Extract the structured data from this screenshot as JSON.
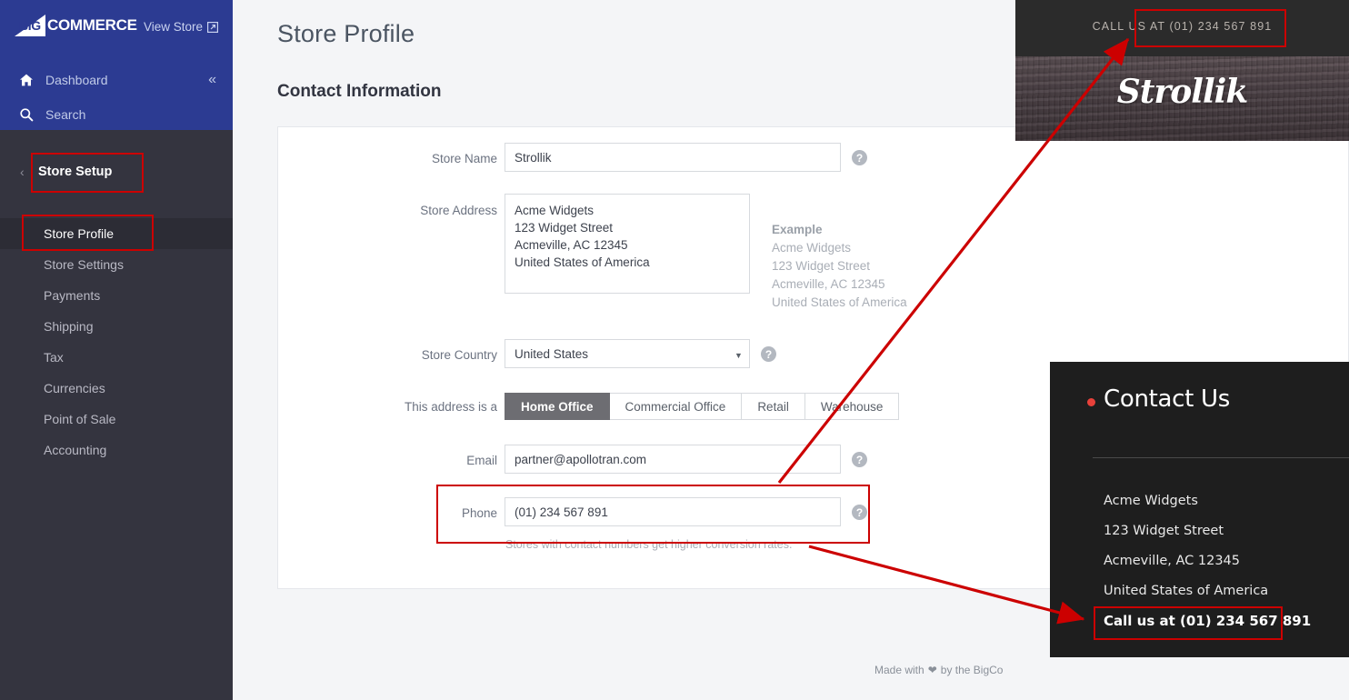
{
  "sidebar": {
    "brand_big": "BIG",
    "brand_name": "COMMERCE",
    "view_store": "View Store",
    "dashboard": "Dashboard",
    "search": "Search",
    "group_label": "Store Setup",
    "items": [
      {
        "label": "Store Profile",
        "active": true
      },
      {
        "label": "Store Settings",
        "active": false
      },
      {
        "label": "Payments",
        "active": false
      },
      {
        "label": "Shipping",
        "active": false
      },
      {
        "label": "Tax",
        "active": false
      },
      {
        "label": "Currencies",
        "active": false
      },
      {
        "label": "Point of Sale",
        "active": false
      },
      {
        "label": "Accounting",
        "active": false
      }
    ]
  },
  "main": {
    "page_title": "Store Profile",
    "section_title": "Contact Information",
    "fields": {
      "store_name_label": "Store Name",
      "store_name_value": "Strollik",
      "store_address_label": "Store Address",
      "store_address_value": "Acme Widgets\n123 Widget Street\nAcmeville, AC 12345\nUnited States of America",
      "example_heading": "Example",
      "example_lines": [
        "Acme Widgets",
        "123 Widget Street",
        "Acmeville, AC 12345",
        "United States of America"
      ],
      "store_country_label": "Store Country",
      "store_country_value": "United States",
      "address_type_label": "This address is a",
      "address_type_options": [
        "Home Office",
        "Commercial Office",
        "Retail",
        "Warehouse"
      ],
      "address_type_selected": "Home Office",
      "email_label": "Email",
      "email_value": "partner@apollotran.com",
      "phone_label": "Phone",
      "phone_value": "(01) 234 567 891",
      "phone_help": "Stores with contact numbers get higher conversion rates.",
      "help_icon": "?"
    },
    "footer": {
      "made_with_prefix": "Made with",
      "made_with_suffix": "by the BigCo"
    }
  },
  "storefront_header": {
    "call_banner": "CALL US AT (01) 234 567 891",
    "logo": "Strollik"
  },
  "storefront_contact": {
    "title": "Contact Us",
    "lines": [
      "Acme Widgets",
      "123 Widget Street",
      "Acmeville, AC 12345",
      "United States of America"
    ],
    "call_line": "Call us at (01) 234 567 891"
  },
  "annotation": {
    "color": "#cc0000"
  }
}
